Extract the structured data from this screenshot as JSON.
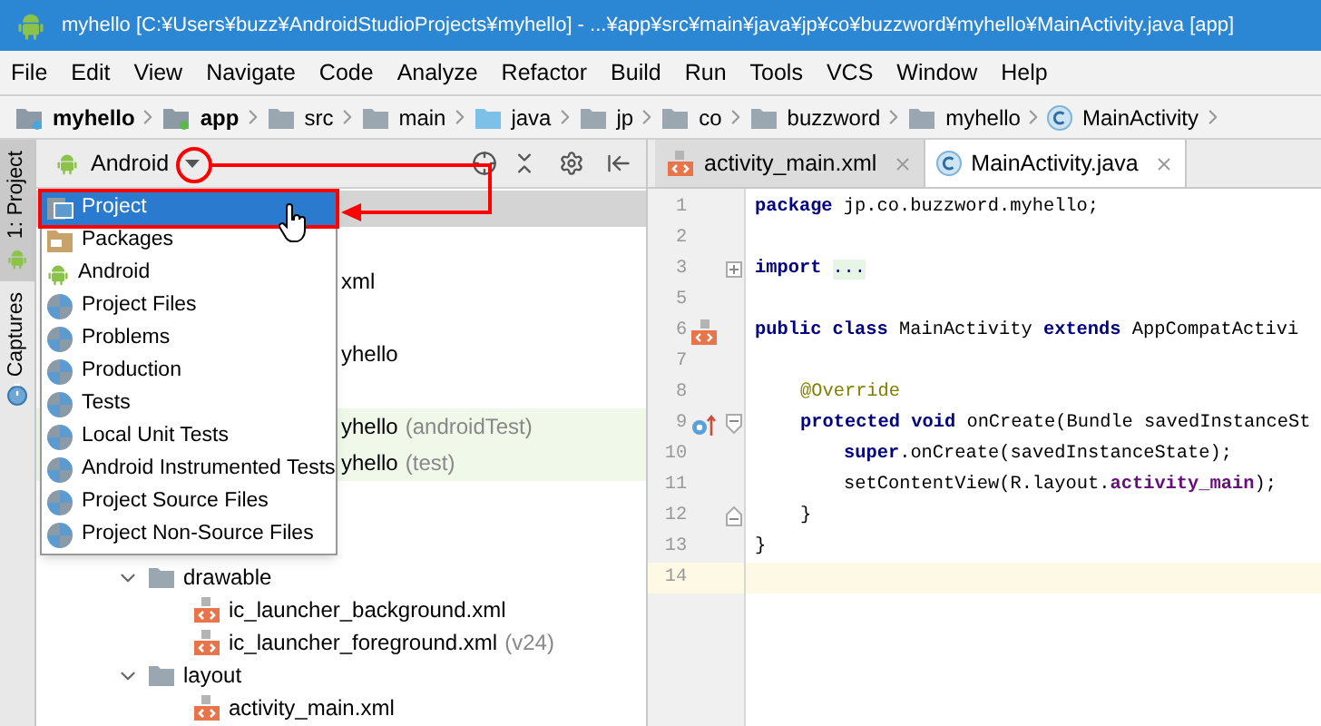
{
  "window": {
    "title": "myhello [C:¥Users¥buzz¥AndroidStudioProjects¥myhello] - ...¥app¥src¥main¥java¥jp¥co¥buzzword¥myhello¥MainActivity.java [app]"
  },
  "menu_bar": [
    "File",
    "Edit",
    "View",
    "Navigate",
    "Code",
    "Analyze",
    "Refactor",
    "Build",
    "Run",
    "Tools",
    "VCS",
    "Window",
    "Help"
  ],
  "breadcrumb": [
    {
      "label": "myhello",
      "kind": "module"
    },
    {
      "label": "app",
      "kind": "app"
    },
    {
      "label": "src",
      "kind": "folder"
    },
    {
      "label": "main",
      "kind": "folder"
    },
    {
      "label": "java",
      "kind": "source"
    },
    {
      "label": "jp",
      "kind": "package"
    },
    {
      "label": "co",
      "kind": "package"
    },
    {
      "label": "buzzword",
      "kind": "package"
    },
    {
      "label": "myhello",
      "kind": "package"
    },
    {
      "label": "MainActivity",
      "kind": "class"
    }
  ],
  "tool_tabs": [
    {
      "label": "1: Project",
      "selected": true
    },
    {
      "label": "Captures",
      "selected": false
    }
  ],
  "project_panel": {
    "view_selector": "Android",
    "dropdown": [
      {
        "label": "Project",
        "kind": "project",
        "selected": true
      },
      {
        "label": "Packages",
        "kind": "packages",
        "selected": false
      },
      {
        "label": "Android",
        "kind": "android",
        "selected": false
      },
      {
        "label": "Project Files",
        "kind": "scope",
        "selected": false
      },
      {
        "label": "Problems",
        "kind": "scope",
        "selected": false
      },
      {
        "label": "Production",
        "kind": "scope",
        "selected": false
      },
      {
        "label": "Tests",
        "kind": "scope",
        "selected": false
      },
      {
        "label": "Local Unit Tests",
        "kind": "scope",
        "selected": false
      },
      {
        "label": "Android Instrumented Tests",
        "kind": "scope",
        "selected": false
      },
      {
        "label": "Project Source Files",
        "kind": "scope",
        "selected": false
      },
      {
        "label": "Project Non-Source Files",
        "kind": "scope",
        "selected": false
      }
    ],
    "hidden_rows": [
      {
        "text": "xml",
        "kind": "source"
      },
      {
        "text": "yhello",
        "kind": "source"
      },
      {
        "text": "yhello",
        "note": "(androidTest)",
        "kind": "test"
      },
      {
        "text": "yhello",
        "note": "(test)",
        "kind": "test"
      }
    ],
    "tree": [
      {
        "name": "drawable",
        "expanded": true,
        "children": [
          {
            "name": "ic_launcher_background.xml"
          },
          {
            "name": "ic_launcher_foreground.xml",
            "note": "(v24)"
          }
        ]
      },
      {
        "name": "layout",
        "expanded": true,
        "children": [
          {
            "name": "activity_main.xml"
          }
        ]
      }
    ]
  },
  "editor": {
    "tabs": [
      {
        "label": "activity_main.xml",
        "kind": "xml",
        "selected": false
      },
      {
        "label": "MainActivity.java",
        "kind": "class",
        "selected": true
      }
    ],
    "lines": [
      {
        "number": "1",
        "kind": "top",
        "tokens": [
          {
            "kind": "kw",
            "text": "package"
          },
          {
            "kind": "plain",
            "text": " jp.co.buzzword.myhello;"
          }
        ]
      },
      {
        "number": "2",
        "kind": "top"
      },
      {
        "number": "3",
        "kind": "top",
        "fold": {
          "kind": "collapsed"
        },
        "tokens": [
          {
            "kind": "kw",
            "text": "import"
          },
          {
            "kind": "folded",
            "text": "..."
          }
        ]
      },
      {
        "number": "5",
        "kind": "top"
      },
      {
        "number": "6",
        "kind": "top",
        "gutter": {
          "kind": "layout"
        },
        "tokens": [
          {
            "kind": "kw",
            "text": "public class"
          },
          {
            "kind": "plain",
            "text": " MainActivity "
          },
          {
            "kind": "kw",
            "text": "extends"
          },
          {
            "kind": "plain",
            "text": " AppCompatActivi"
          }
        ]
      },
      {
        "number": "7",
        "kind": "top"
      },
      {
        "number": "8",
        "kind": "member",
        "tokens": [
          {
            "kind": "annotation",
            "text": "@Override"
          }
        ]
      },
      {
        "number": "9",
        "kind": "member",
        "gutter": {
          "kind": "override"
        },
        "fold": {
          "kind": "open"
        },
        "tokens": [
          {
            "kind": "kw",
            "text": "protected void"
          },
          {
            "kind": "plain",
            "text": " onCreate(Bundle savedInstanceSt"
          }
        ]
      },
      {
        "number": "10",
        "kind": "body",
        "tokens": [
          {
            "kind": "kw",
            "text": "super"
          },
          {
            "kind": "plain",
            "text": ".onCreate(savedInstanceState);"
          }
        ]
      },
      {
        "number": "11",
        "kind": "body",
        "tokens": [
          {
            "kind": "plain",
            "text": "setContentView(R.layout."
          },
          {
            "kind": "field",
            "text": "activity_main"
          },
          {
            "kind": "plain",
            "text": ");"
          }
        ]
      },
      {
        "number": "12",
        "kind": "member",
        "fold": {
          "kind": "end"
        },
        "tokens": [
          {
            "kind": "plain",
            "text": "}"
          }
        ]
      },
      {
        "number": "13",
        "kind": "top",
        "tokens": [
          {
            "kind": "plain",
            "text": "}"
          }
        ]
      },
      {
        "number": "14",
        "kind": "top",
        "current": true
      }
    ]
  }
}
